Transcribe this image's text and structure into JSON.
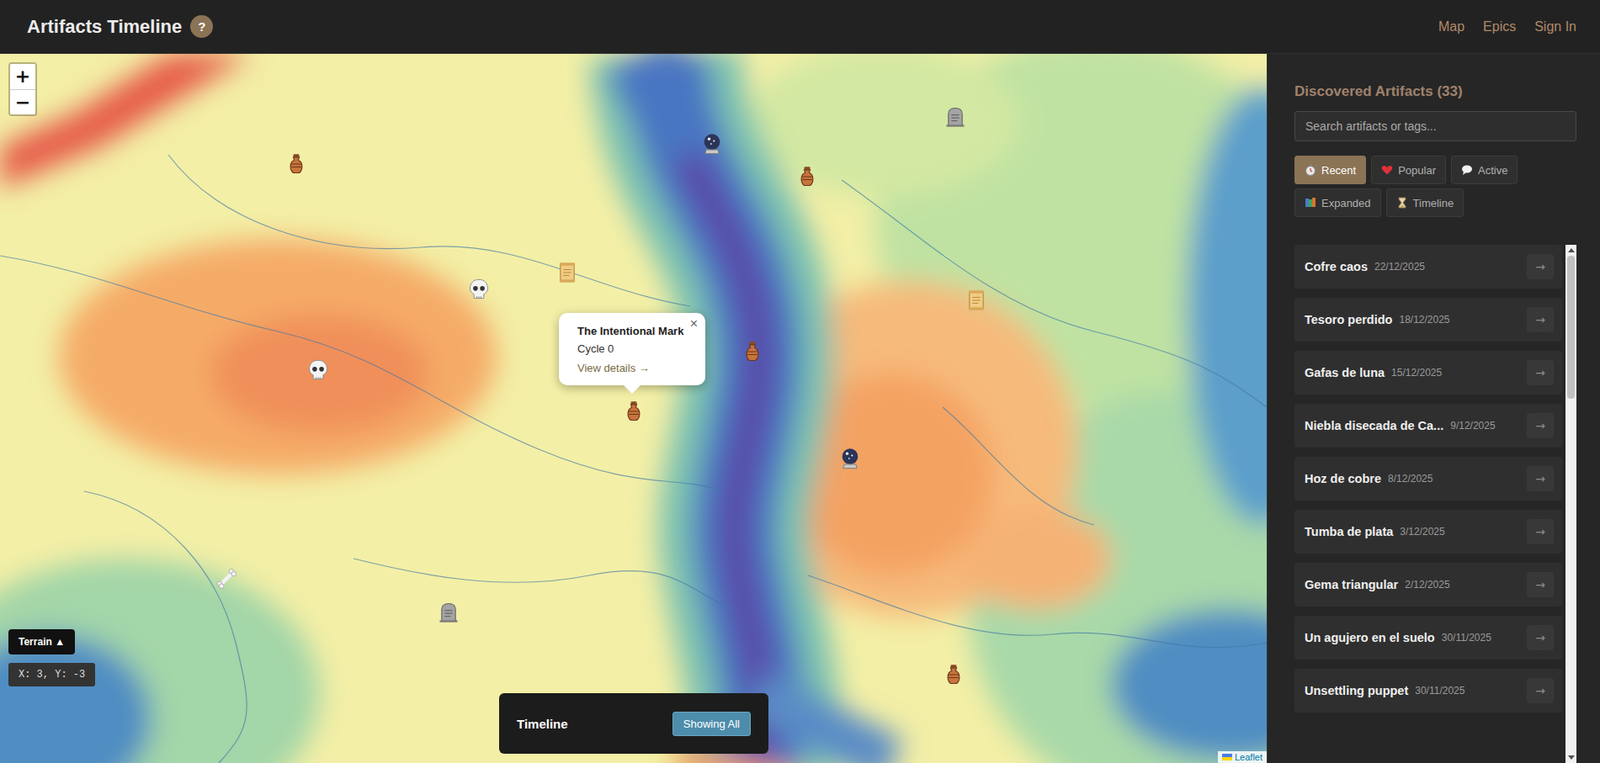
{
  "header": {
    "title": "Artifacts Timeline",
    "help": "?",
    "nav": [
      {
        "label": "Map"
      },
      {
        "label": "Epics"
      },
      {
        "label": "Sign In"
      }
    ]
  },
  "map": {
    "zoom_in": "+",
    "zoom_out": "−",
    "terrain_button": "Terrain ▲",
    "coordinates": "X: 3, Y: -3",
    "attribution": "Leaflet",
    "pins": [
      {
        "kind": "amphora"
      },
      {
        "kind": "orb"
      },
      {
        "kind": "amphora"
      },
      {
        "kind": "tombstone"
      },
      {
        "kind": "scroll"
      },
      {
        "kind": "skull"
      },
      {
        "kind": "scroll"
      },
      {
        "kind": "skull"
      },
      {
        "kind": "amphora"
      },
      {
        "kind": "amphora"
      },
      {
        "kind": "orb"
      },
      {
        "kind": "bone"
      },
      {
        "kind": "tombstone"
      },
      {
        "kind": "amphora"
      }
    ],
    "popup": {
      "title": "The Intentional Mark",
      "subtitle": "Cycle 0",
      "link": "View details →",
      "close": "×"
    },
    "timeline": {
      "title": "Timeline",
      "button": "Showing All"
    }
  },
  "sidebar": {
    "title": "Discovered Artifacts (33)",
    "search": {
      "placeholder": "Search artifacts or tags..."
    },
    "filters": [
      {
        "label": "Recent",
        "kind": "clock",
        "selected": true
      },
      {
        "label": "Popular",
        "kind": "heart",
        "selected": false
      },
      {
        "label": "Active",
        "kind": "bubble",
        "selected": false
      },
      {
        "label": "Expanded",
        "kind": "books",
        "selected": false
      },
      {
        "label": "Timeline",
        "kind": "hourglass",
        "selected": false
      }
    ],
    "artifacts": [
      {
        "name": "Cofre caos",
        "date": "22/12/2025",
        "action": "→"
      },
      {
        "name": "Tesoro perdido",
        "date": "18/12/2025",
        "action": "→"
      },
      {
        "name": "Gafas de luna",
        "date": "15/12/2025",
        "action": "→"
      },
      {
        "name": "Niebla disecada de Ca...",
        "date": "9/12/2025",
        "action": "→"
      },
      {
        "name": "Hoz de cobre",
        "date": "8/12/2025",
        "action": "→"
      },
      {
        "name": "Tumba de plata",
        "date": "3/12/2025",
        "action": "→"
      },
      {
        "name": "Gema triangular",
        "date": "2/12/2025",
        "action": "→"
      },
      {
        "name": "Un agujero en el suelo",
        "date": "30/11/2025",
        "action": "→"
      },
      {
        "name": "Unsettling puppet",
        "date": "30/11/2025",
        "action": "→"
      }
    ]
  }
}
